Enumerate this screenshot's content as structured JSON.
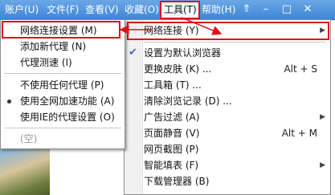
{
  "menubar": {
    "items": [
      {
        "label": "账户(U)"
      },
      {
        "label": "文件(F)"
      },
      {
        "label": "查看(V)"
      },
      {
        "label": "收藏(O)"
      },
      {
        "label": "工具(T)"
      },
      {
        "label": "帮助(H)"
      }
    ],
    "icons": [
      "pin-icon",
      "minimize-icon",
      "maximize-icon",
      "close-icon"
    ]
  },
  "proxy_menu": {
    "items": [
      {
        "label": "网络连接设置 (M)"
      },
      {
        "label": "添加新代理 (N)"
      },
      {
        "label": "代理测速 (I)"
      },
      {
        "label": "不使用任何代理 (P)"
      },
      {
        "label": "使用全网加速功能 (A)"
      },
      {
        "label": "使用IE的代理设置 (O)"
      },
      {
        "label": "(空)"
      }
    ]
  },
  "tools_menu": {
    "items": [
      {
        "label": "网络连接 (Y)"
      },
      {
        "label": "设置为默认浏览器"
      },
      {
        "label": "更换皮肤 (K) ...",
        "shortcut": "Alt + S"
      },
      {
        "label": "工具箱 (T) ..."
      },
      {
        "label": "清除浏览记录 (D) ..."
      },
      {
        "label": "广告过滤 (A)"
      },
      {
        "label": "页面静音 (V)",
        "shortcut": "Alt + M"
      },
      {
        "label": "网页截图 (P)"
      },
      {
        "label": "智能填表 (F)"
      },
      {
        "label": "下载管理器 (B)"
      }
    ]
  },
  "colors": {
    "highlight": "#e0101a",
    "menubar": "#3f86d8",
    "check": "#2a6fd0"
  }
}
